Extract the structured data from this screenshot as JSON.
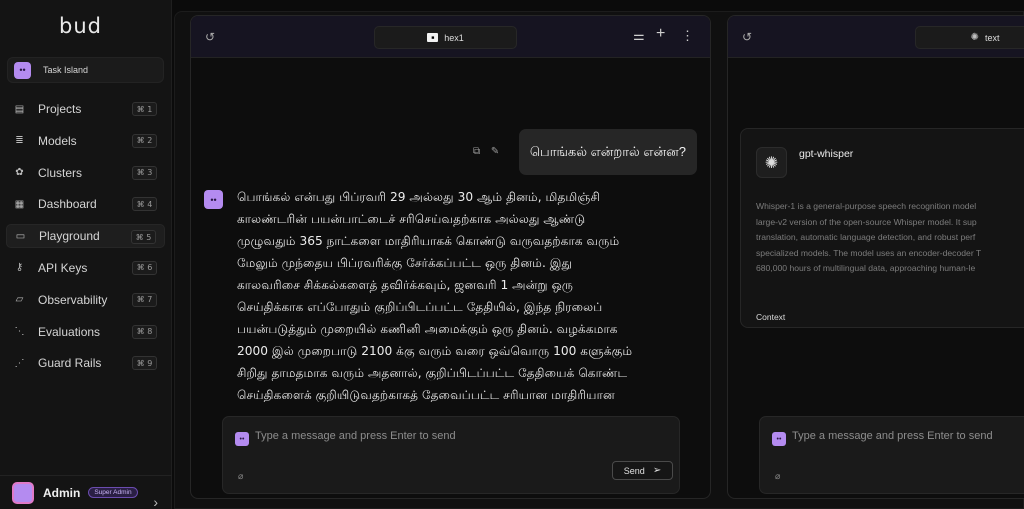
{
  "sidebar": {
    "logo": "bud",
    "project": {
      "label": "Task Island"
    },
    "items": [
      {
        "label": "Projects",
        "shortcut": "⌘ 1",
        "icon": "file-icon"
      },
      {
        "label": "Models",
        "shortcut": "⌘ 2",
        "icon": "database-icon"
      },
      {
        "label": "Clusters",
        "shortcut": "⌘ 3",
        "icon": "cluster-icon"
      },
      {
        "label": "Dashboard",
        "shortcut": "⌘ 4",
        "icon": "grid-icon"
      },
      {
        "label": "Playground",
        "shortcut": "⌘ 5",
        "icon": "chat-icon"
      },
      {
        "label": "API Keys",
        "shortcut": "⌘ 6",
        "icon": "key-icon"
      },
      {
        "label": "Observability",
        "shortcut": "⌘ 7",
        "icon": "folder-icon"
      },
      {
        "label": "Evaluations",
        "shortcut": "⌘ 8",
        "icon": "flow-icon"
      },
      {
        "label": "Guard Rails",
        "shortcut": "⌘ 9",
        "icon": "guard-icon"
      }
    ],
    "active_item": "Playground",
    "user": {
      "name": "Admin",
      "badge": "Super Admin"
    }
  },
  "panel1": {
    "model_tab": "hex1",
    "user_message": "பொங்கல் என்றால் என்ன?",
    "assistant_message": "பொங்கல் என்பது பிப்ரவரி 29 அல்லது 30 ஆம் தினம், மிதமிஞ்சி\nகாலண்டரின் பயன்பாட்டைச் சரிசெய்வதற்காக அல்லது ஆண்டு\nமுழுவதும் 365 நாட்களை மாதிரியாகக் கொண்டு வருவதற்காக வரும்\nமேலும் முந்தைய பிப்ரவரிக்கு சேர்க்கப்பட்ட ஒரு தினம். இது\nகாலவரிசை சிக்கல்களைத் தவிர்க்கவும், ஜனவரி 1 அன்று ஒரு\nசெய்திக்காக எப்போதும் குறிப்பிடப்பட்ட தேதியில், இந்த நிரலைப்\nபயன்படுத்தும் முறையில் கணினி அமைக்கும் ஒரு தினம். வழக்கமாக\n2000 இல் முறைபாடு 2100 க்கு வரும் வரை ஒவ்வொரு 100 களுக்கும்\nசிறிது தாமதமாக வரும் அதனால், குறிப்பிடப்பட்ட தேதியைக் கொண்ட\nசெய்திகளைக் குறியிடுவதற்காகத் தேவைப்பட்ட சரியான மாதிரியான",
    "composer_placeholder": "Type a message and press Enter to send",
    "send_label": "Send"
  },
  "panel2": {
    "model_tab": "text",
    "model_name": "gpt-whisper",
    "description_lines": [
      "Whisper-1 is a general-purpose speech recognition model",
      "large-v2 version of the open-source Whisper model. It sup",
      "translation, automatic language detection, and robust perf",
      "specialized models. The model uses an encoder-decoder T",
      "680,000 hours of multilingual data, approaching human-le"
    ],
    "context_label": "Context",
    "composer_placeholder": "Type a message and press Enter to send"
  }
}
